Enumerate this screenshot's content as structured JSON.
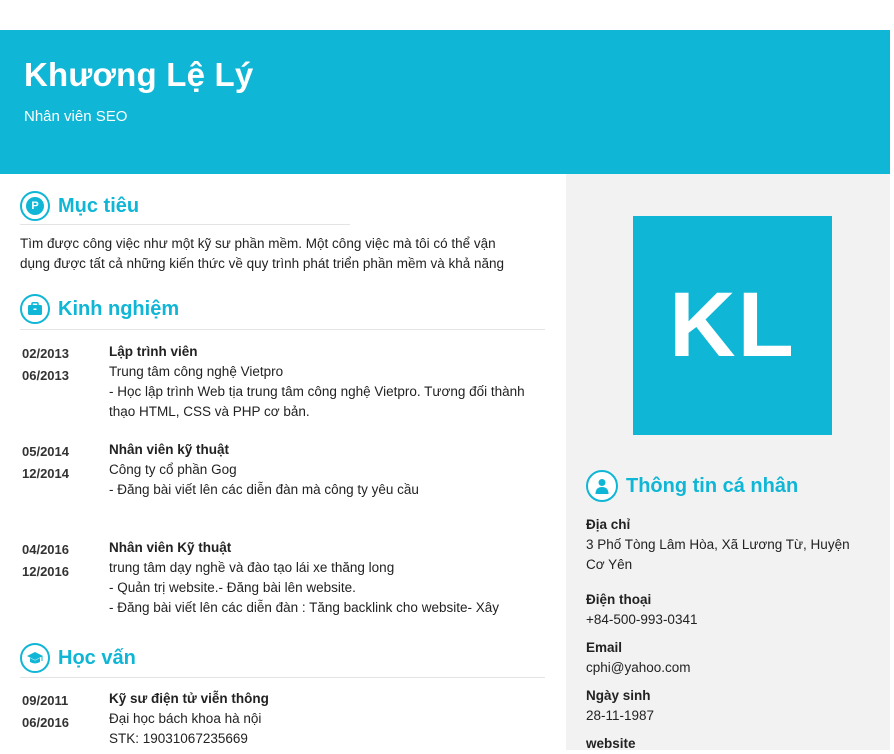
{
  "header": {
    "name": "Khương Lệ Lý",
    "role": "Nhân viên SEO"
  },
  "avatar": {
    "initials": "KL"
  },
  "sections": {
    "objective": "Mục tiêu",
    "experience": "Kinh nghiệm",
    "education": "Học vấn",
    "personal": "Thông tin cá nhân"
  },
  "objective": {
    "line1": "Tìm được công việc như một kỹ sư phần mềm. Một công việc mà tôi có thể vận",
    "line2": "dụng được tất cả những kiến thức về quy trình phát triển phần mềm và khả năng"
  },
  "experience": [
    {
      "from": "02/2013",
      "to": "06/2013",
      "title": "Lập trình viên",
      "company": "Trung tâm công nghệ Vietpro",
      "lines": [
        "- Học lập trình Web tịa trung tâm công nghệ Vietpro. Tương đối thành",
        "thạo HTML, CSS và PHP cơ bản."
      ]
    },
    {
      "from": "05/2014",
      "to": "12/2014",
      "title": "Nhân viên kỹ thuật",
      "company": "Công ty cổ phần Gog",
      "lines": [
        "- Đăng bài viết lên các diễn đàn mà công ty yêu cầu",
        ""
      ]
    },
    {
      "from": "04/2016",
      "to": "12/2016",
      "title": "Nhân viên Kỹ thuật",
      "company": "trung tâm dạy nghề và đào tạo lái xe thăng long",
      "lines": [
        "- Quản trị website.- Đăng bài lên website.",
        "- Đăng bài viết lên các diễn đàn : Tăng backlink cho website- Xây"
      ]
    }
  ],
  "education": [
    {
      "from": "09/2011",
      "to": "06/2016",
      "title": "Kỹ sư điện tử viễn thông",
      "school": "Đại học bách khoa hà nội",
      "note": "STK: 19031067235669"
    }
  ],
  "personal": {
    "address_label": "Địa chỉ",
    "address_line1": "3 Phố Tòng Lâm Hòa, Xã Lương Từ, Huyện",
    "address_line2": "Cơ Yên",
    "phone_label": "Điện thoại",
    "phone": "+84-500-993-0341",
    "email_label": "Email",
    "email": "cphi@yahoo.com",
    "dob_label": "Ngày sinh",
    "dob": "28-11-1987",
    "website_label": "website"
  },
  "colors": {
    "accent": "#0fb6d5",
    "sidebar": "#f2f2f2"
  },
  "icons": {
    "objective": "pinterest-icon",
    "experience": "briefcase-icon",
    "education": "graduation-cap-icon",
    "personal": "user-icon"
  }
}
